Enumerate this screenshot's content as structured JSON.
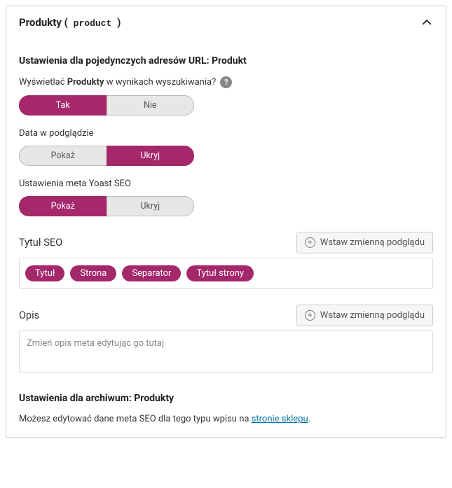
{
  "header": {
    "title_prefix": "Produkty (",
    "slug": " product ",
    "title_suffix": ")"
  },
  "section1": {
    "heading": "Ustawienia dla pojedynczych adresów URL: Produkt",
    "show_in_search": {
      "label_pre": "Wyświetlać ",
      "label_bold": "Produkty",
      "label_post": " w wynikach wyszukiwania?",
      "yes": "Tak",
      "no": "Nie"
    },
    "date_preview": {
      "label": "Data w podglądzie",
      "show": "Pokaż",
      "hide": "Ukryj"
    },
    "yoast_meta": {
      "label": "Ustawienia meta Yoast SEO",
      "show": "Pokaż",
      "hide": "Ukryj"
    }
  },
  "seo_title": {
    "label": "Tytuł SEO",
    "insert_btn": "Wstaw zmienną podglądu",
    "tags": [
      "Tytuł",
      "Strona",
      "Separator",
      "Tytuł strony"
    ]
  },
  "description": {
    "label": "Opis",
    "insert_btn": "Wstaw zmienną podglądu",
    "placeholder": "Zmień opis meta edytując go tutaj"
  },
  "archive": {
    "heading": "Ustawienia dla archiwum: Produkty",
    "text_pre": "Możesz edytować dane meta SEO dla tego typu wpisu na ",
    "link": "stronie sklepu",
    "text_post": "."
  }
}
